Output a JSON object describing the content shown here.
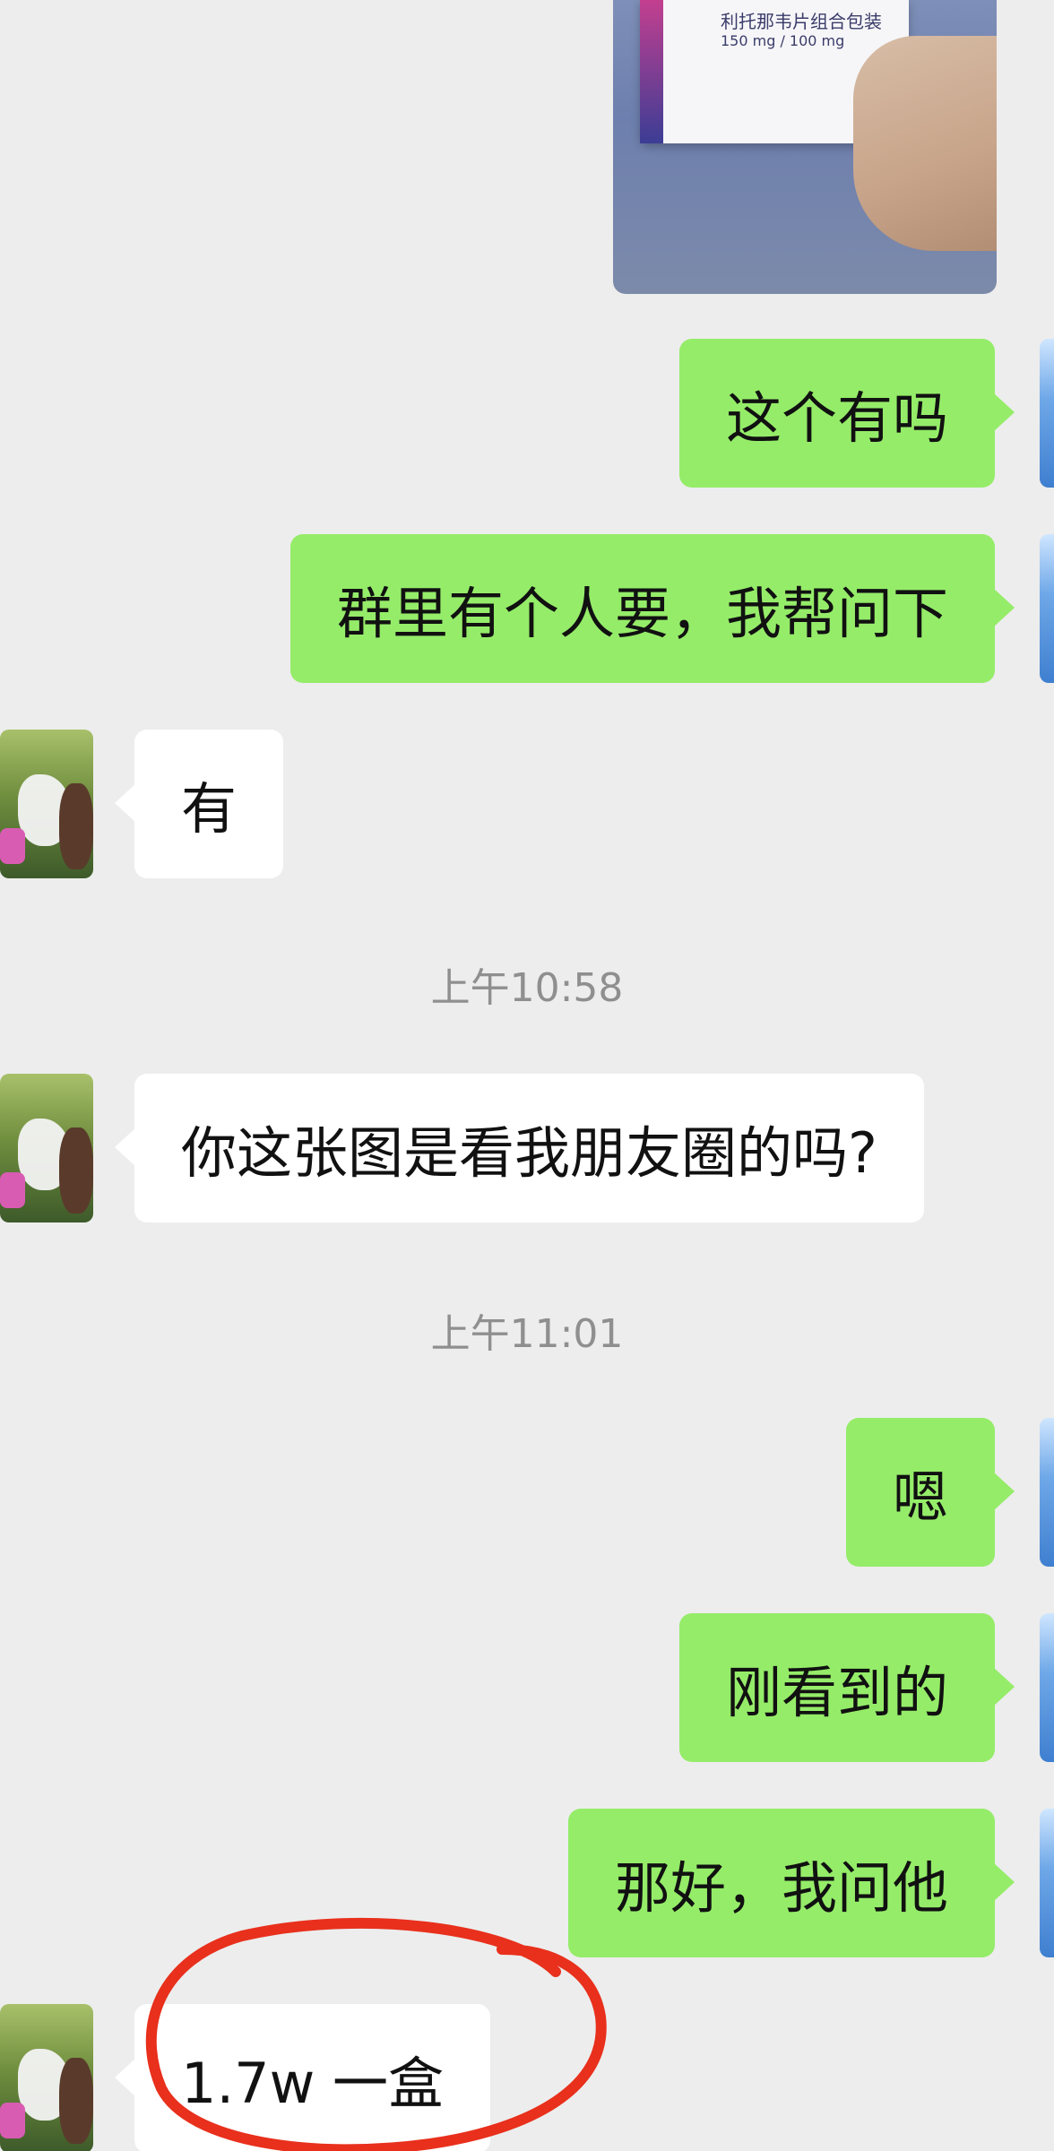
{
  "image_message": {
    "box_line_1": "利托那韦片组合包装",
    "box_line_2": "150 mg / 100 mg"
  },
  "messages": [
    {
      "side": "right",
      "text": "这个有吗"
    },
    {
      "side": "right",
      "text": "群里有个人要，我帮问下"
    },
    {
      "side": "left",
      "text": "有"
    },
    {
      "timestamp": "上午10:58"
    },
    {
      "side": "left",
      "text": "你这张图是看我朋友圈的吗?"
    },
    {
      "timestamp": "上午11:01"
    },
    {
      "side": "right",
      "text": "嗯"
    },
    {
      "side": "right",
      "text": "刚看到的"
    },
    {
      "side": "right",
      "text": "那好，我问他"
    },
    {
      "side": "left",
      "text": "1.7w 一盒"
    }
  ],
  "colors": {
    "background": "#ededed",
    "my_bubble": "#95ec69",
    "their_bubble": "#ffffff",
    "annotation": "#e8301c"
  }
}
